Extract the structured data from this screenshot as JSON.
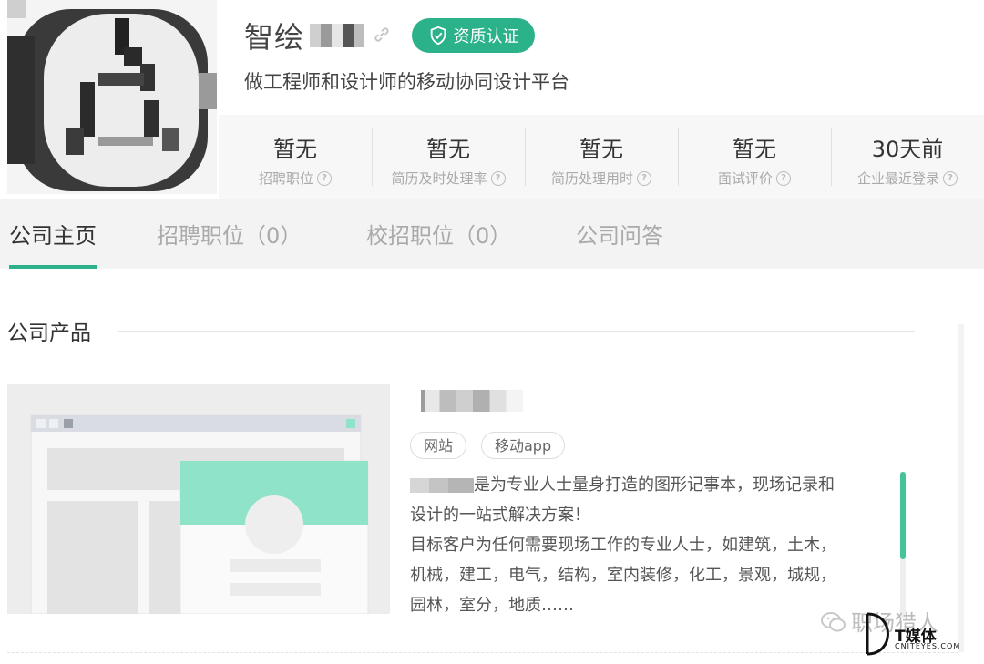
{
  "header": {
    "company_name": "智绘",
    "certification_label": "资质认证",
    "slogan": "做工程师和设计师的移动协同设计平台"
  },
  "stats": [
    {
      "value": "暂无",
      "label": "招聘职位"
    },
    {
      "value": "暂无",
      "label": "简历及时处理率"
    },
    {
      "value": "暂无",
      "label": "简历处理用时"
    },
    {
      "value": "暂无",
      "label": "面试评价"
    },
    {
      "value": "30天前",
      "label": "企业最近登录"
    }
  ],
  "tabs": [
    {
      "label": "公司主页"
    },
    {
      "label": "招聘职位（0）"
    },
    {
      "label": "校招职位（0）"
    },
    {
      "label": "公司问答"
    }
  ],
  "products_section": {
    "title": "公司产品",
    "product": {
      "tags": [
        "网站",
        "移动app"
      ],
      "description_lines": [
        "是为专业人士量身打造的图形记事本，现场记录和",
        "设计的一站式解决方案！",
        "目标客户为任何需要现场工作的专业人士，如建筑，土木，",
        "机械，建工，电气，结构，室内装修，化工，景观，城规，",
        "园林，室分，地质……"
      ]
    }
  },
  "watermark": {
    "text": "职场猎人",
    "brand_cn": "T媒体",
    "brand_en": "CNITEYES.COM"
  },
  "colors": {
    "accent": "#2bb28a",
    "stats_bg": "#f7f7f7",
    "tabbar_bg": "#f3f3f3"
  }
}
